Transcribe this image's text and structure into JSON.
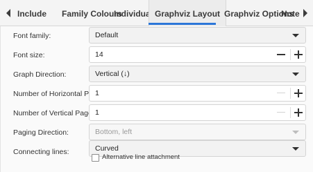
{
  "tabs": {
    "items": [
      {
        "label": "Include"
      },
      {
        "label": "Family Colours"
      },
      {
        "label": "Individuals"
      },
      {
        "label": "Graphviz Layout"
      },
      {
        "label": "Graphviz Options"
      },
      {
        "label": "Note"
      }
    ],
    "active_index": 3,
    "accent_color": "#2b76d8",
    "scroll_left_icon": "triangle-left-icon",
    "scroll_right_icon": "triangle-right-icon"
  },
  "form": {
    "font_family": {
      "label": "Font family:",
      "value": "Default"
    },
    "font_size": {
      "label": "Font size:",
      "value": "14"
    },
    "graph_direction": {
      "label": "Graph Direction:",
      "value": "Vertical (↓)"
    },
    "horizontal_pages": {
      "label": "Number of Horizontal Pages:",
      "value": "1"
    },
    "vertical_pages": {
      "label": "Number of Vertical Pages:",
      "value": "1"
    },
    "paging_direction": {
      "label": "Paging Direction:",
      "value": "Bottom, left",
      "disabled": true
    },
    "connecting_lines": {
      "label": "Connecting lines:",
      "value": "Curved"
    },
    "alt_line_attachment": {
      "label": "Alternative line attachment",
      "checked": false
    }
  }
}
